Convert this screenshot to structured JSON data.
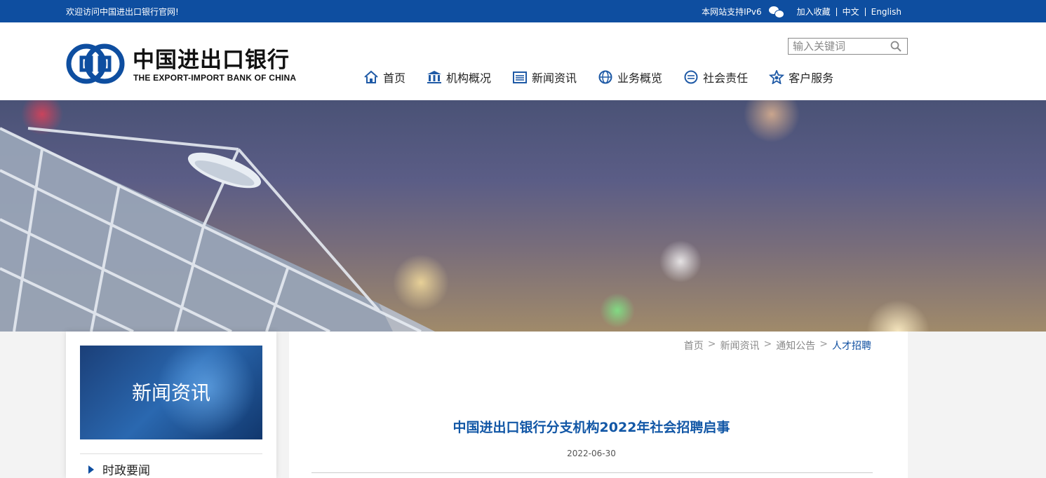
{
  "topbar": {
    "welcome": "欢迎访问中国进出口银行官网!",
    "ipv6": "本网站支持IPv6",
    "favorite": "加入收藏",
    "lang_cn": "中文",
    "lang_en": "English"
  },
  "logo": {
    "cn": "中国进出口银行",
    "en": "THE EXPORT-IMPORT BANK OF CHINA"
  },
  "search": {
    "placeholder": "输入关键词"
  },
  "nav": {
    "items": [
      {
        "label": "首页",
        "icon": "home-icon"
      },
      {
        "label": "机构概况",
        "icon": "institution-icon"
      },
      {
        "label": "新闻资讯",
        "icon": "news-icon"
      },
      {
        "label": "业务概览",
        "icon": "globe-icon"
      },
      {
        "label": "社会责任",
        "icon": "chat-icon"
      },
      {
        "label": "客户服务",
        "icon": "service-icon"
      }
    ]
  },
  "sidebar": {
    "banner_title": "新闻资讯",
    "items": [
      {
        "label": "时政要闻"
      }
    ]
  },
  "breadcrumb": {
    "items": [
      "首页",
      "新闻资讯",
      "通知公告"
    ],
    "current": "人才招聘"
  },
  "article": {
    "title": "中国进出口银行分支机构2022年社会招聘启事",
    "date": "2022-06-30"
  },
  "colors": {
    "brand_blue": "#0e4ea0",
    "title_blue": "#1257a6"
  }
}
